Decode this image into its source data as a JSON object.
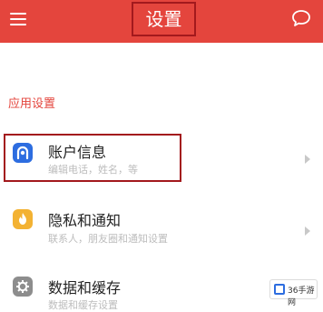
{
  "header": {
    "title": "设置",
    "menu_icon": "hamburger-menu-icon",
    "chat_icon": "chat-bubble-icon",
    "background_color": "#e4453d"
  },
  "section": {
    "title": "应用设置"
  },
  "items": [
    {
      "label": "账户信息",
      "sub": "编辑电话，姓名，等",
      "icon": "account-icon",
      "icon_color": "#2d6de0"
    },
    {
      "label": "隐私和通知",
      "sub": "联系人，朋友圈和通知设置",
      "icon": "privacy-flame-icon",
      "icon_color": "#f3b233"
    },
    {
      "label": "数据和缓存",
      "sub": "数据和缓存设置",
      "icon": "gear-icon",
      "icon_color": "#8d8d8d"
    }
  ],
  "watermark": {
    "text": "36手游网"
  }
}
